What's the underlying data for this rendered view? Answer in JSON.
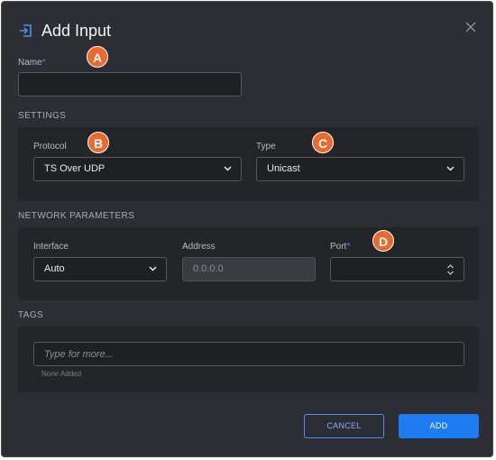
{
  "dialog": {
    "title": "Add Input",
    "title_icon": "sign-in-icon",
    "close_icon": "close-icon"
  },
  "badges": {
    "a": "A",
    "b": "B",
    "c": "C",
    "d": "D"
  },
  "name": {
    "label": "Name",
    "required_mark": "*",
    "value": ""
  },
  "settings": {
    "heading": "SETTINGS",
    "protocol": {
      "label": "Protocol",
      "value": "TS Over UDP"
    },
    "type": {
      "label": "Type",
      "value": "Unicast"
    }
  },
  "network": {
    "heading": "NETWORK PARAMETERS",
    "interface": {
      "label": "Interface",
      "value": "Auto"
    },
    "address": {
      "label": "Address",
      "value": "0.0.0.0"
    },
    "port": {
      "label": "Port",
      "required_mark": "*",
      "value": ""
    }
  },
  "tags": {
    "heading": "TAGS",
    "placeholder": "Type for more...",
    "empty_text": "None Added"
  },
  "buttons": {
    "cancel": "CANCEL",
    "add": "ADD"
  },
  "colors": {
    "accent": "#1f7bf2",
    "badge": "#ea6a2e",
    "background": "#2c2e33"
  }
}
